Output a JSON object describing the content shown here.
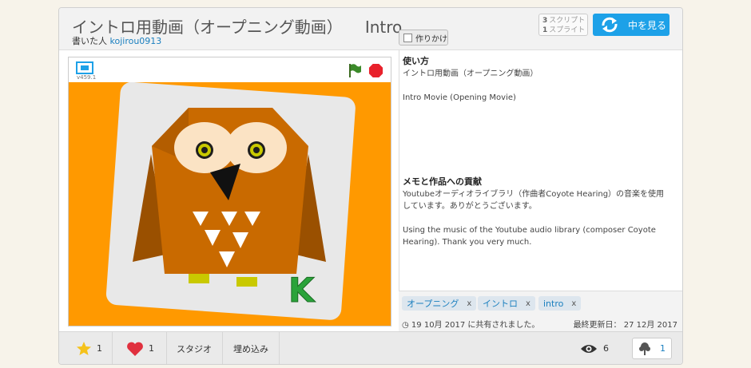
{
  "header": {
    "title": "イントロ用動画（オープニング動画）",
    "title_en": "Intro",
    "author_prefix": "書いた人",
    "author": "kojirou0913",
    "scripts_count": "3",
    "scripts_label": "スクリプト",
    "sprites_count": "1",
    "sprites_label": "スプライト",
    "see_inside_label": "中を見る",
    "draft_label": "作りかけ"
  },
  "player": {
    "version": "v459.1",
    "sprite_letter": "K"
  },
  "instructions": {
    "heading": "使い方",
    "line1": "イントロ用動画（オープニング動画）",
    "line2": "Intro Movie (Opening Movie)"
  },
  "notes": {
    "heading": "メモと作品への貢献",
    "line1": "Youtubeオーディオライブラリ（作曲者Coyote Hearing）の音楽を使用",
    "line2": "しています。ありがとうございます。",
    "line3": "Using the music of the Youtube audio library (composer Coyote",
    "line4": "Hearing). Thank you very much."
  },
  "tags": [
    {
      "label": "オープニング",
      "remove": "x"
    },
    {
      "label": "イントロ",
      "remove": "x"
    },
    {
      "label": "intro",
      "remove": "x"
    }
  ],
  "meta": {
    "shared": "19 10月 2017 に共有されました。",
    "updated": "最終更新日： 27 12月 2017"
  },
  "footer": {
    "favorites": "1",
    "loves": "1",
    "studio_label": "スタジオ",
    "embed_label": "埋め込み",
    "views": "6",
    "remixes": "1"
  },
  "colors": {
    "accent": "#1da1e8",
    "stage": "#ff9900",
    "owl_body": "#c96a00",
    "stop": "#e8212b",
    "flag": "#3b8a2a"
  },
  "icons": [
    "fullscreen-icon",
    "green-flag-icon",
    "stop-icon",
    "see-inside-icon",
    "star-icon",
    "heart-icon",
    "eye-icon",
    "remix-tree-icon"
  ]
}
